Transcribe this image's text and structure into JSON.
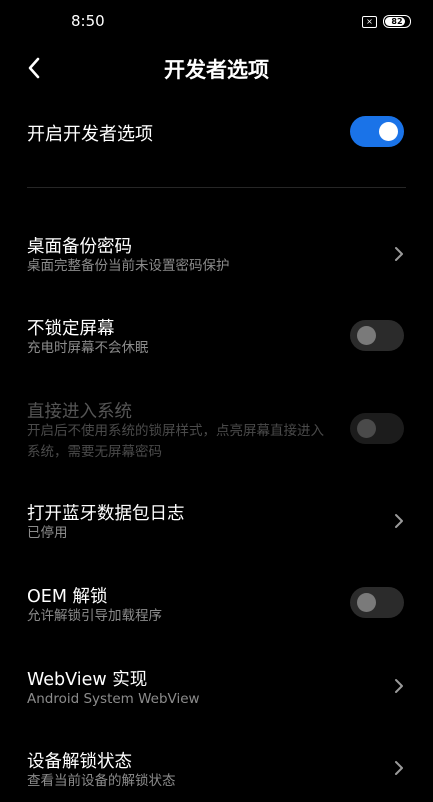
{
  "status_bar": {
    "time": "8:50",
    "sim_icon": "no-sim-icon",
    "sim_glyph": "×",
    "battery_level": "82",
    "battery_fraction": 0.82
  },
  "header": {
    "title": "开发者选项",
    "back_icon": "back-chevron-icon"
  },
  "master": {
    "label": "开启开发者选项",
    "enabled": true
  },
  "colors": {
    "accent": "#1a73e8",
    "background": "#000000",
    "subtitle": "#8c8c8c"
  },
  "items": [
    {
      "key": "desktop-backup-password",
      "title": "桌面备份密码",
      "subtitle": "桌面完整备份当前未设置密码保护",
      "control": "chevron"
    },
    {
      "key": "stay-awake",
      "title": "不锁定屏幕",
      "subtitle": "充电时屏幕不会休眠",
      "control": "toggle",
      "on": false
    },
    {
      "key": "direct-enter-system",
      "title": "直接进入系统",
      "subtitle": "开启后不使用系统的锁屏样式，点亮屏幕直接进入系统，需要无屏幕密码",
      "control": "toggle",
      "on": false,
      "disabled": true
    },
    {
      "key": "bluetooth-hci-log",
      "title": "打开蓝牙数据包日志",
      "subtitle": "已停用",
      "control": "chevron"
    },
    {
      "key": "oem-unlock",
      "title": "OEM 解锁",
      "subtitle": "允许解锁引导加载程序",
      "control": "toggle",
      "on": false
    },
    {
      "key": "webview-implementation",
      "title": "WebView 实现",
      "subtitle": "Android System WebView",
      "control": "chevron"
    },
    {
      "key": "device-unlock-status",
      "title": "设备解锁状态",
      "subtitle": "查看当前设备的解锁状态",
      "control": "chevron"
    }
  ]
}
